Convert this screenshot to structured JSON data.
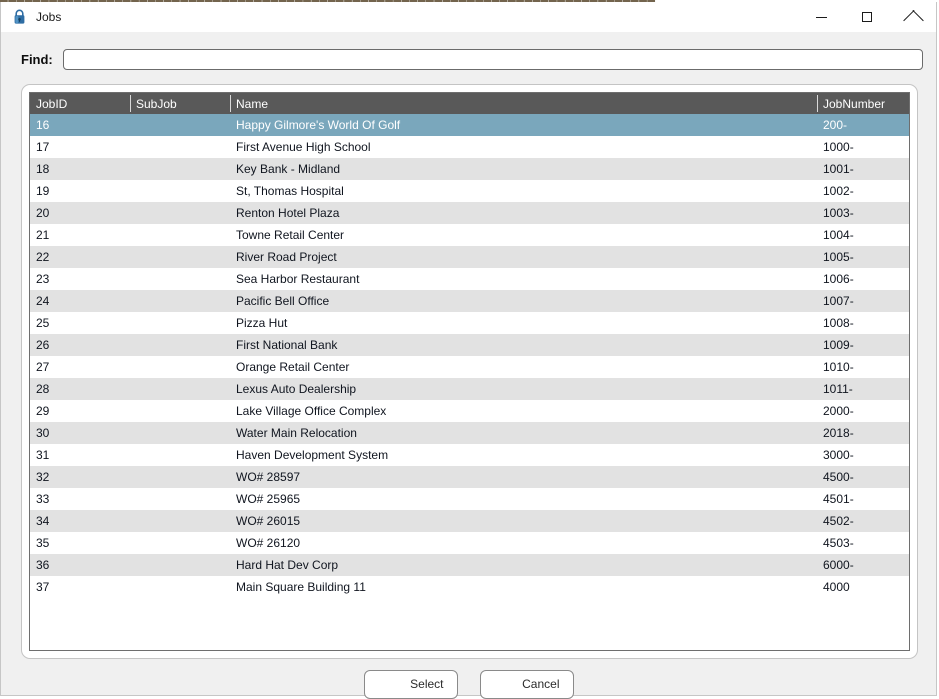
{
  "window": {
    "title": "Jobs",
    "icon": "lock-icon",
    "background_strip_text": "▄▄▄▄▄▄▄▄▄▄▄▄▄▄▄▄▄▄▄▄▄▄▄▄▄▄▄▄▄▄▄▄▄▄▄▄▄▄▄▄▄▄▄▄▄▄▄▄▄▄▄▄▄▄▄▄▄▄▄▄▄▄▄▄▄▄▄▄▄▄▄▄▄▄▄▄▄▄▄▄",
    "controls": {
      "minimize": "minimize-icon",
      "maximize": "maximize-icon",
      "close": "close-icon"
    }
  },
  "find": {
    "label": "Find:",
    "value": "",
    "placeholder": ""
  },
  "grid": {
    "columns": [
      "JobID",
      "SubJob",
      "Name",
      "JobNumber"
    ],
    "selected_index": 0,
    "rows": [
      {
        "jobid": "16",
        "subjob": "",
        "name": "Happy Gilmore's World Of Golf",
        "jobnumber": "200-"
      },
      {
        "jobid": "17",
        "subjob": "",
        "name": "First Avenue High School",
        "jobnumber": "1000-"
      },
      {
        "jobid": "18",
        "subjob": "",
        "name": "Key Bank - Midland",
        "jobnumber": "1001-"
      },
      {
        "jobid": "19",
        "subjob": "",
        "name": "St, Thomas Hospital",
        "jobnumber": "1002-"
      },
      {
        "jobid": "20",
        "subjob": "",
        "name": "Renton Hotel Plaza",
        "jobnumber": "1003-"
      },
      {
        "jobid": "21",
        "subjob": "",
        "name": "Towne Retail Center",
        "jobnumber": "1004-"
      },
      {
        "jobid": "22",
        "subjob": "",
        "name": "River Road Project",
        "jobnumber": "1005-"
      },
      {
        "jobid": "23",
        "subjob": "",
        "name": "Sea Harbor Restaurant",
        "jobnumber": "1006-"
      },
      {
        "jobid": "24",
        "subjob": "",
        "name": "Pacific Bell Office",
        "jobnumber": "1007-"
      },
      {
        "jobid": "25",
        "subjob": "",
        "name": "Pizza Hut",
        "jobnumber": "1008-"
      },
      {
        "jobid": "26",
        "subjob": "",
        "name": "First National Bank",
        "jobnumber": "1009-"
      },
      {
        "jobid": "27",
        "subjob": "",
        "name": "Orange Retail Center",
        "jobnumber": "1010-"
      },
      {
        "jobid": "28",
        "subjob": "",
        "name": "Lexus Auto Dealership",
        "jobnumber": "1011-"
      },
      {
        "jobid": "29",
        "subjob": "",
        "name": "Lake Village Office Complex",
        "jobnumber": "2000-"
      },
      {
        "jobid": "30",
        "subjob": "",
        "name": "Water Main Relocation",
        "jobnumber": "2018-"
      },
      {
        "jobid": "31",
        "subjob": "",
        "name": "Haven Development System",
        "jobnumber": "3000-"
      },
      {
        "jobid": "32",
        "subjob": "",
        "name": "WO# 28597",
        "jobnumber": "4500-"
      },
      {
        "jobid": "33",
        "subjob": "",
        "name": "WO# 25965",
        "jobnumber": "4501-"
      },
      {
        "jobid": "34",
        "subjob": "",
        "name": "WO# 26015",
        "jobnumber": "4502-"
      },
      {
        "jobid": "35",
        "subjob": "",
        "name": "WO# 26120",
        "jobnumber": "4503-"
      },
      {
        "jobid": "36",
        "subjob": "",
        "name": "Hard Hat Dev Corp",
        "jobnumber": "6000-"
      },
      {
        "jobid": "37",
        "subjob": "",
        "name": "Main Square Building 11",
        "jobnumber": "4000"
      }
    ]
  },
  "footer": {
    "select_label": "Select",
    "cancel_label": "Cancel"
  },
  "colors": {
    "header_bg": "#595959",
    "selection_bg": "#7aa7bc",
    "row_alt_bg": "#e2e2e2",
    "window_bg": "#f0f0f0"
  }
}
